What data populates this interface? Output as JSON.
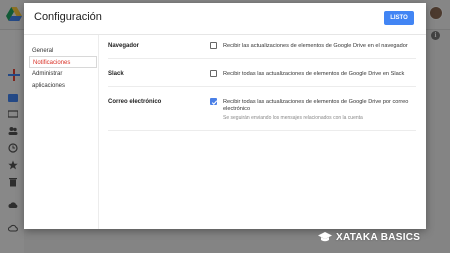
{
  "dialog": {
    "title": "Configuración",
    "done_label": "LISTO"
  },
  "nav": {
    "items": [
      {
        "label": "General"
      },
      {
        "label": "Notificaciones"
      },
      {
        "label": "Administrar aplicaciones"
      }
    ],
    "active_index": 1
  },
  "settings": [
    {
      "label": "Navegador",
      "text": "Recibir las actualizaciones de elementos de Google Drive en el navegador",
      "checked": false
    },
    {
      "label": "Slack",
      "text": "Recibir todas las actualizaciones de elementos de Google Drive en Slack",
      "checked": false
    },
    {
      "label": "Correo electrónico",
      "text": "Recibir todas las actualizaciones de elementos de Google Drive por correo electrónico",
      "subtext": "Se seguirán enviando los mensajes relacionados con la cuenta",
      "checked": true
    }
  ],
  "background": {
    "info_icon": "i"
  },
  "watermark": {
    "text": "XATAKA BASICS",
    "icon": "graduation-cap-icon"
  },
  "colors": {
    "accent": "#4285f4",
    "active_nav": "#d93025",
    "checkbox_on": "#4a7fe6"
  }
}
